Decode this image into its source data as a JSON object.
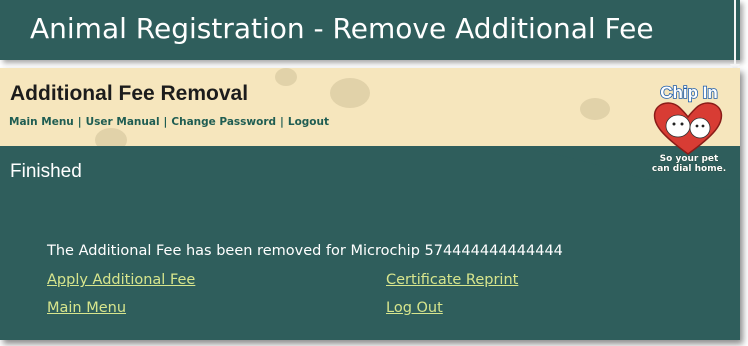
{
  "window": {
    "title": "Animal Registration - Remove Additional Fee"
  },
  "header": {
    "title": "Additional Fee Removal",
    "nav": [
      "Main Menu",
      "User Manual",
      "Change Password",
      "Logout"
    ]
  },
  "logo": {
    "top_text": "Chip In",
    "tagline_line1": "So your pet",
    "tagline_line2": "can dial home."
  },
  "status": {
    "heading": "Finished"
  },
  "message": "The Additional Fee has been removed for Microchip 574444444444444",
  "links": {
    "apply_fee": "Apply Additional Fee",
    "certificate_reprint": "Certificate Reprint",
    "main_menu": "Main Menu",
    "log_out": "Log Out"
  },
  "colors": {
    "panel": "#2f5e5c",
    "header": "#f6e6bd",
    "link": "#d7e58d",
    "nav": "#1f5d52"
  }
}
